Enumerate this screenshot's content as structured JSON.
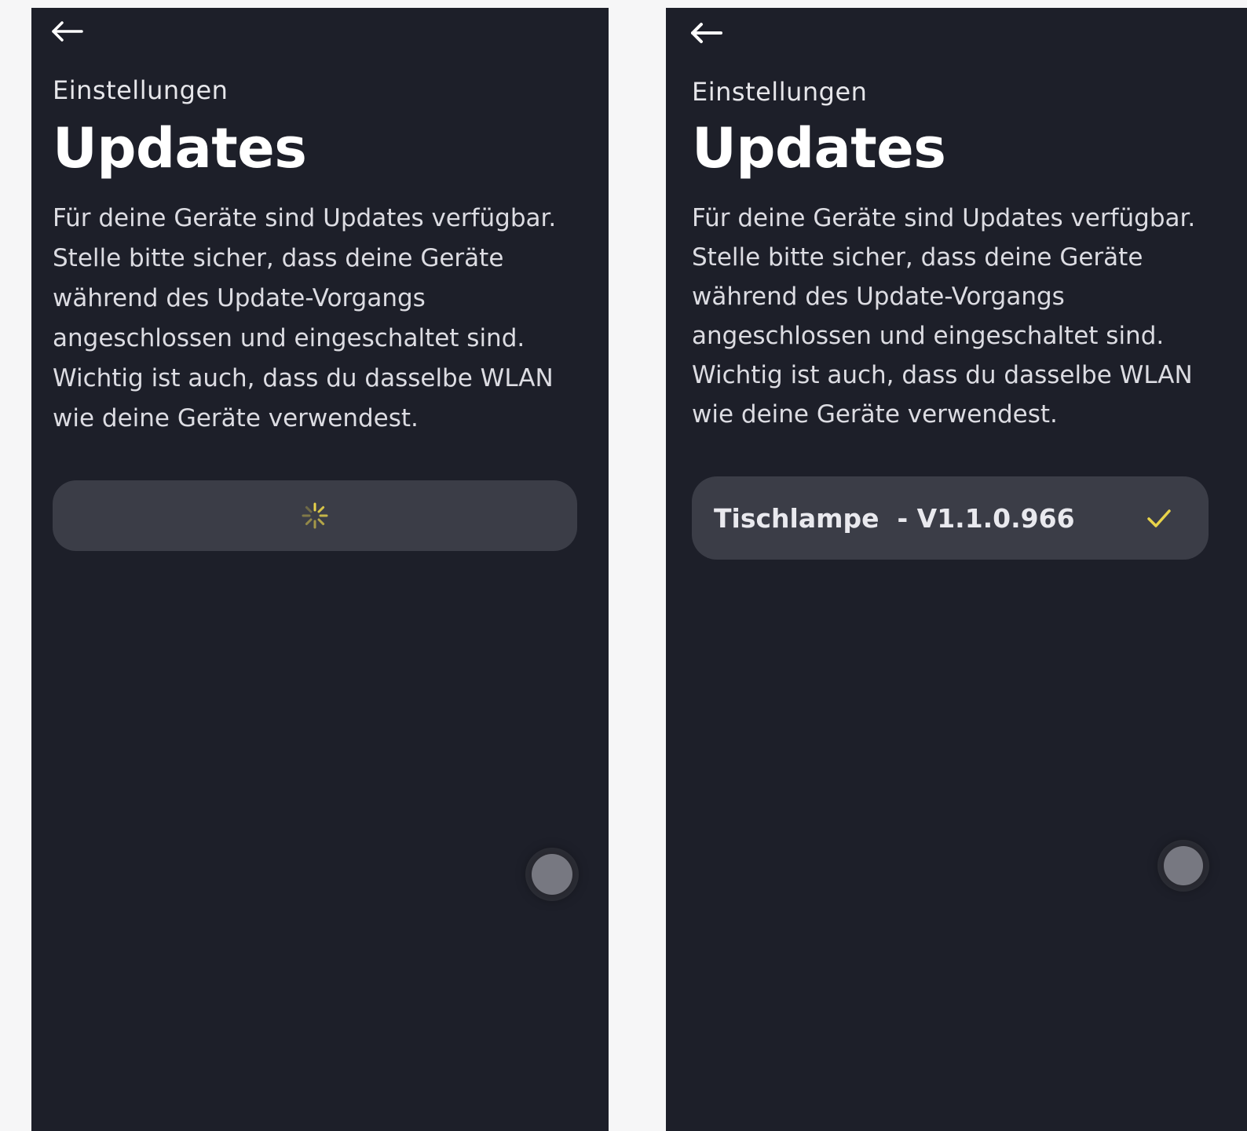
{
  "screens": [
    {
      "back_icon": "arrow-left-icon",
      "breadcrumb": "Einstellungen",
      "title": "Updates",
      "description": "Für deine Geräte sind Updates verfügbar. Stelle bitte sicher, dass deine Geräte während des Update-Vorgangs angeschlossen und eingeschaltet sind. Wichtig ist auch, dass du dasselbe WLAN wie deine Geräte verwendest.",
      "loading_icon": "spinner-icon",
      "accent_color": "#e8d34a"
    },
    {
      "back_icon": "arrow-left-icon",
      "breadcrumb": "Einstellungen",
      "title": "Updates",
      "description": "Für deine Geräte sind Updates verfügbar. Stelle bitte sicher, dass deine Geräte während des Update-Vorgangs angeschlossen und eingeschaltet sind. Wichtig ist auch, dass du dasselbe WLAN wie deine Geräte verwendest.",
      "device": {
        "label": "Tischlampe  - V1.1.0.966",
        "status_icon": "check-icon"
      },
      "accent_color": "#e8d34a"
    }
  ]
}
